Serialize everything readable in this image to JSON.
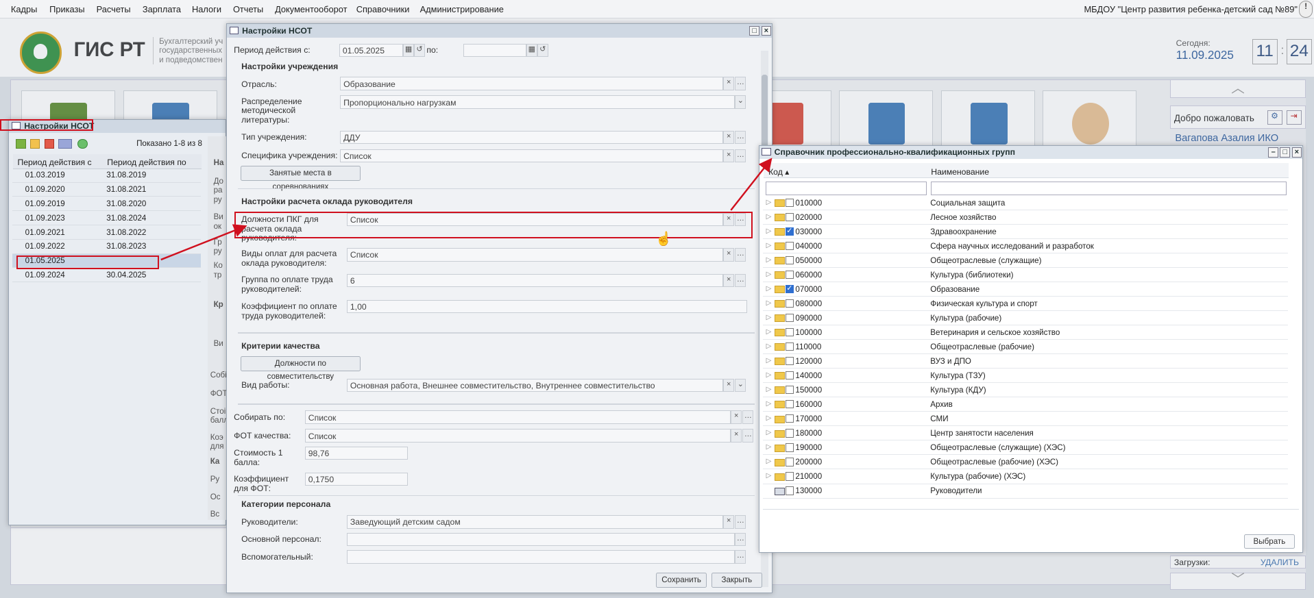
{
  "menu": [
    "Кадры",
    "Приказы",
    "Расчеты",
    "Зарплата",
    "Налоги",
    "Отчеты",
    "Документооборот",
    "Справочники",
    "Администрирование"
  ],
  "org": "МБДОУ \"Центр развития ребенка-детский сад №89\"",
  "header": {
    "logo": "ГИС РТ",
    "subtitle": [
      "Бухгалтерский уч",
      "государственных",
      "и подведомствен"
    ],
    "today_label": "Сегодня:",
    "today": "11.09.2025",
    "hh": "11",
    "mm": "24"
  },
  "rpanel": {
    "welcome": "Добро пожаловать",
    "user": "Вагапова Азалия ИКО",
    "uploads": "Загрузки:",
    "delete": "УДАЛИТЬ"
  },
  "lwin": {
    "title": "Настройки НСОТ",
    "shown": "Показано 1-8 из 8",
    "col1": "Период действия с",
    "col2": "Период действия по",
    "rows": [
      [
        "01.03.2019",
        "31.08.2019"
      ],
      [
        "01.09.2020",
        "31.08.2021"
      ],
      [
        "01.09.2019",
        "31.08.2020"
      ],
      [
        "01.09.2023",
        "31.08.2024"
      ],
      [
        "01.09.2021",
        "31.08.2022"
      ],
      [
        "01.09.2022",
        "31.08.2023"
      ],
      [
        "01.05.2025",
        ""
      ],
      [
        "01.09.2024",
        "30.04.2025"
      ]
    ],
    "peek": [
      "На",
      "До",
      "ра",
      "ру",
      "Ви",
      "ок",
      "Гр",
      "ру",
      "Ко",
      "тр",
      "Кр",
      "Ви",
      "Собі",
      "ФОТ",
      "Стоі",
      "балл",
      "Коэ",
      "для",
      "Ка",
      "Ру",
      "Ос",
      "Вс"
    ]
  },
  "mwin": {
    "title": "Настройки НСОТ",
    "period_from": "Период действия с:",
    "period_from_val": "01.05.2025",
    "period_to": "по:",
    "s1": "Настройки учреждения",
    "otrasl": "Отрасль:",
    "otrasl_v": "Образование",
    "raspr": [
      "Распределение",
      "методической",
      "литературы:"
    ],
    "raspr_v": "Пропорционально нагрузкам",
    "tip": "Тип учреждения:",
    "tip_v": "ДДУ",
    "spec": "Специфика учреждения:",
    "spec_v": "Список",
    "zanyat": "Занятые места в соревнованиях",
    "s2": "Настройки расчета оклада руководителя",
    "dolzh": [
      "Должности ПКГ для",
      "расчета оклада",
      "руководителя:"
    ],
    "dolzh_v": "Список",
    "vidy": [
      "Виды оплат для расчета",
      "оклада руководителя:"
    ],
    "vidy_v": "Список",
    "gruppa": [
      "Группа по оплате труда",
      "руководителей:"
    ],
    "gruppa_v": "6",
    "koef": [
      "Коэффициент по оплате",
      "труда руководителей:"
    ],
    "koef_v": "1,00",
    "s3": "Критерии качества",
    "sovm": "Должности по совместительству",
    "vid": "Вид работы:",
    "vid_v": "Основная работа, Внешнее совместительство, Внутреннее совместительство",
    "sobir": "Собирать по:",
    "sobir_v": "Список",
    "fot": "ФОТ качества:",
    "fot_v": "Список",
    "stoim": [
      "Стоимость 1",
      "балла:"
    ],
    "stoim_v": "98,76",
    "kfot": [
      "Коэффициент",
      "для ФОТ:"
    ],
    "kfot_v": "0,1750",
    "s4": "Категории персонала",
    "ruk": "Руководители:",
    "ruk_v": "Заведующий детским садом",
    "osn": "Основной персонал:",
    "vsp": "Вспомогательный:",
    "save": "Сохранить",
    "close": "Закрыть"
  },
  "rwin": {
    "title": "Справочник профессионально-квалификационных групп",
    "col1": "Код",
    "col2": "Наименование",
    "select": "Выбрать",
    "rows": [
      [
        "010000",
        "Социальная защита",
        false
      ],
      [
        "020000",
        "Лесное хозяйство",
        false
      ],
      [
        "030000",
        "Здравоохранение",
        true
      ],
      [
        "040000",
        "Сфера научных исследований и разработок",
        false
      ],
      [
        "050000",
        "Общеотраслевые (служащие)",
        false
      ],
      [
        "060000",
        "Культура (библиотеки)",
        false
      ],
      [
        "070000",
        "Образование",
        true
      ],
      [
        "080000",
        "Физическая культура и спорт",
        false
      ],
      [
        "090000",
        "Культура (рабочие)",
        false
      ],
      [
        "100000",
        "Ветеринария и сельское хозяйство",
        false
      ],
      [
        "110000",
        "Общеотраслевые (рабочие)",
        false
      ],
      [
        "120000",
        "ВУЗ и ДПО",
        false
      ],
      [
        "140000",
        "Культура (ТЗУ)",
        false
      ],
      [
        "150000",
        "Культура (КДУ)",
        false
      ],
      [
        "160000",
        "Архив",
        false
      ],
      [
        "170000",
        "СМИ",
        false
      ],
      [
        "180000",
        "Центр занятости населения",
        false
      ],
      [
        "190000",
        "Общеотраслевые (служащие) (ХЭС)",
        false
      ],
      [
        "200000",
        "Общеотраслевые (рабочие) (ХЭС)",
        false
      ],
      [
        "210000",
        "Культура (рабочие) (ХЭС)",
        false
      ],
      [
        "130000",
        "Руководители",
        false
      ]
    ]
  }
}
